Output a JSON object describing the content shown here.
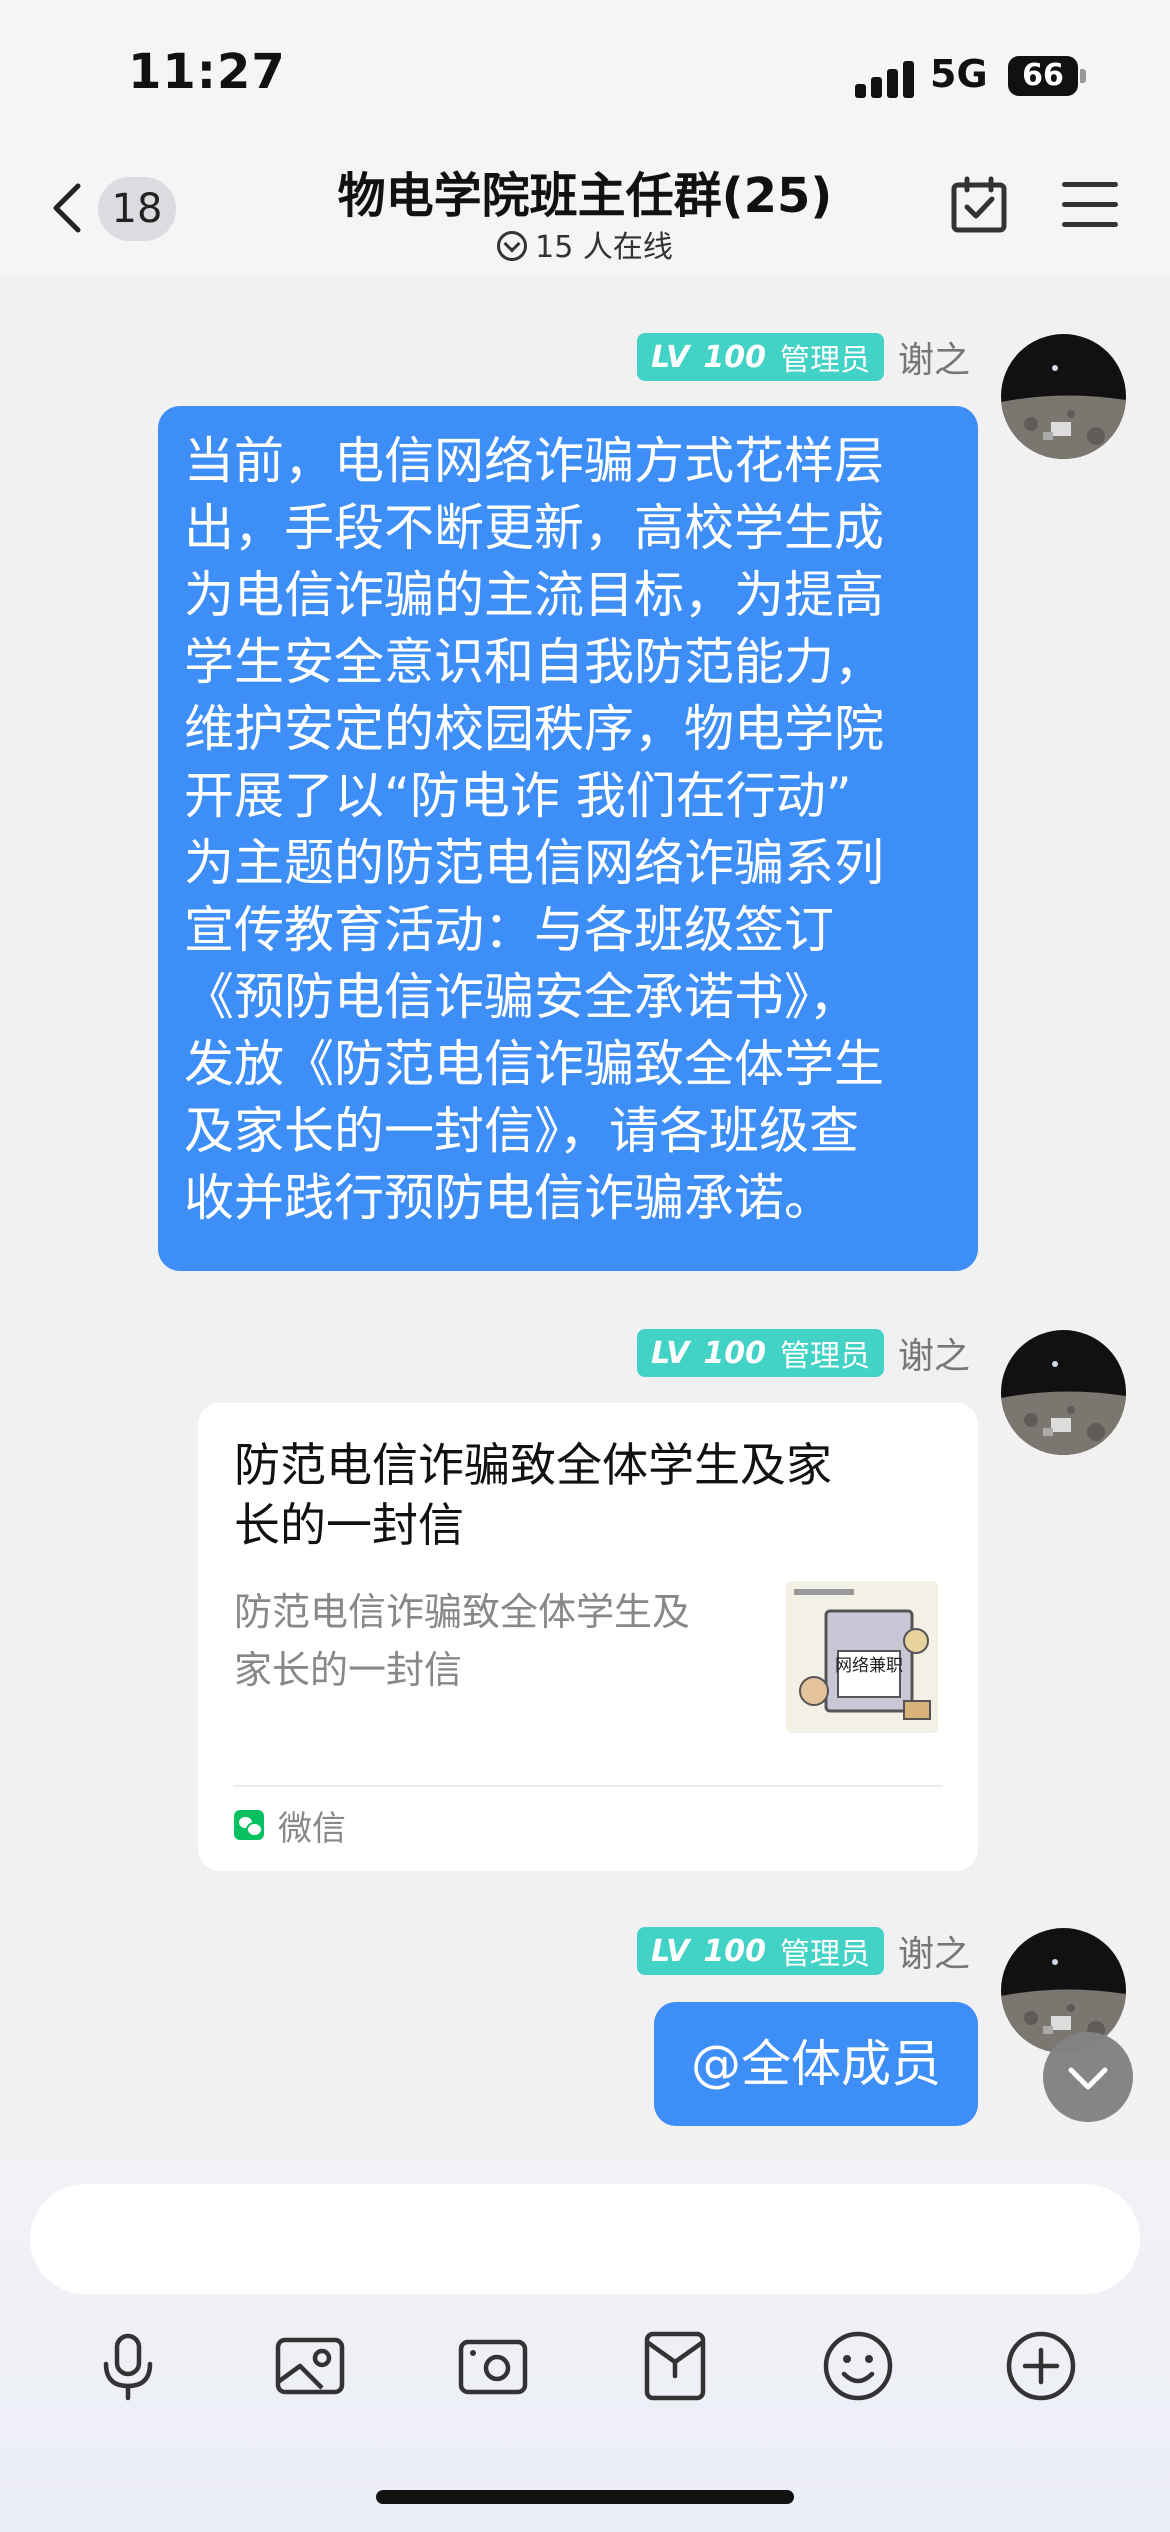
{
  "status_bar": {
    "time": "11:27",
    "network": "5G",
    "battery": "66"
  },
  "header": {
    "back_count": "18",
    "title": "物电学院班主任群(25)",
    "online": "15 人在线"
  },
  "messages": [
    {
      "level_prefix": "LV",
      "level": "100",
      "role": "管理员",
      "sender": "谢之",
      "lines": [
        "当前，电信网络诈骗方式花样层",
        "出，手段不断更新，高校学生成",
        "为电信诈骗的主流目标，为提高",
        "学生安全意识和自我防范能力，",
        "维护安定的校园秩序，物电学院",
        "开展了以“防电诈 我们在行动”",
        "为主题的防范电信网络诈骗系列",
        "宣传教育活动：与各班级签订",
        "《预防电信诈骗安全承诺书》，",
        "发放《防范电信诈骗致全体学生",
        "及家长的一封信》，请各班级查",
        "收并践行预防电信诈骗承诺。"
      ]
    },
    {
      "level_prefix": "LV",
      "level": "100",
      "role": "管理员",
      "sender": "谢之",
      "card": {
        "title_lines": [
          "防范电信诈骗致全体学生及家",
          "长的一封信"
        ],
        "desc_lines": [
          "防范电信诈骗致全体学生及",
          "家长的一封信"
        ],
        "source": "微信",
        "thumb_text": "网络兼职"
      }
    },
    {
      "level_prefix": "LV",
      "level": "100",
      "role": "管理员",
      "sender": "谢之",
      "text": "@全体成员"
    }
  ],
  "toolbar": {
    "items": [
      "microphone-icon",
      "image-icon",
      "camera-icon",
      "file-icon",
      "emoji-icon",
      "plus-icon"
    ]
  },
  "colors": {
    "bubble": "#3e8ef7",
    "level_badge": "#43d2c6",
    "wechat": "#07c160"
  }
}
